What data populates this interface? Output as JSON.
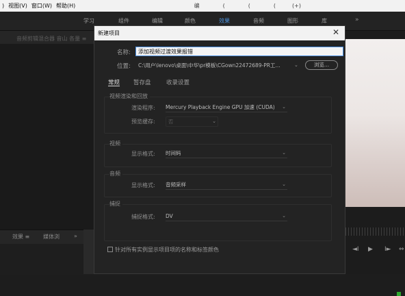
{
  "menubar": {
    "items": [
      ")",
      "视图(V)",
      "窗口(W)",
      "帮助(H)"
    ],
    "fragments": [
      "编",
      "(",
      "(",
      "(",
      "(+)"
    ]
  },
  "workspace": {
    "tabs": [
      "学习",
      "组件",
      "编辑",
      "颜色",
      "效果",
      "音频",
      "图形",
      "库"
    ],
    "active": "效果",
    "more": "»"
  },
  "background": {
    "left_faint_text": "音频剪辑混合器 音山 各量 ≡",
    "bottom_tabs": [
      "效果 ≡",
      "媒体浏",
      "»"
    ],
    "player_controls": [
      "◄I",
      "▶",
      "I►",
      "⇔"
    ]
  },
  "dialog": {
    "title": "新建项目",
    "close": "✕",
    "name_label": "名称:",
    "name_value": "添加视频过渡效果报错",
    "location_label": "位置:",
    "location_value": "C:\\用户\\lenovo\\桌面\\中华\\pr模板\\CGown22472689-PR工...",
    "browse_label": "浏览...",
    "tabs": [
      "常规",
      "暂存盘",
      "收录设置"
    ],
    "active_tab": "常规",
    "sections": {
      "video_render": {
        "title": "视频渲染和回放",
        "renderer_label": "渲染程序:",
        "renderer_value": "Mercury Playback Engine GPU 加速 (CUDA)",
        "preview_cache_label": "预览缓存:",
        "preview_cache_value": "否"
      },
      "video": {
        "title": "视频",
        "display_format_label": "显示格式:",
        "display_format_value": "时间码"
      },
      "audio": {
        "title": "音频",
        "display_format_label": "显示格式:",
        "display_format_value": "音频采样"
      },
      "capture": {
        "title": "捕捉",
        "capture_format_label": "捕捉格式:",
        "capture_format_value": "DV"
      }
    },
    "checkbox_label": "针对所有实例显示项目项的名称和标签颜色",
    "checkbox_checked": false
  },
  "colors": {
    "accent": "#4a8fd8",
    "dialog_bg": "#232323",
    "app_bg": "#1d1d1d"
  }
}
